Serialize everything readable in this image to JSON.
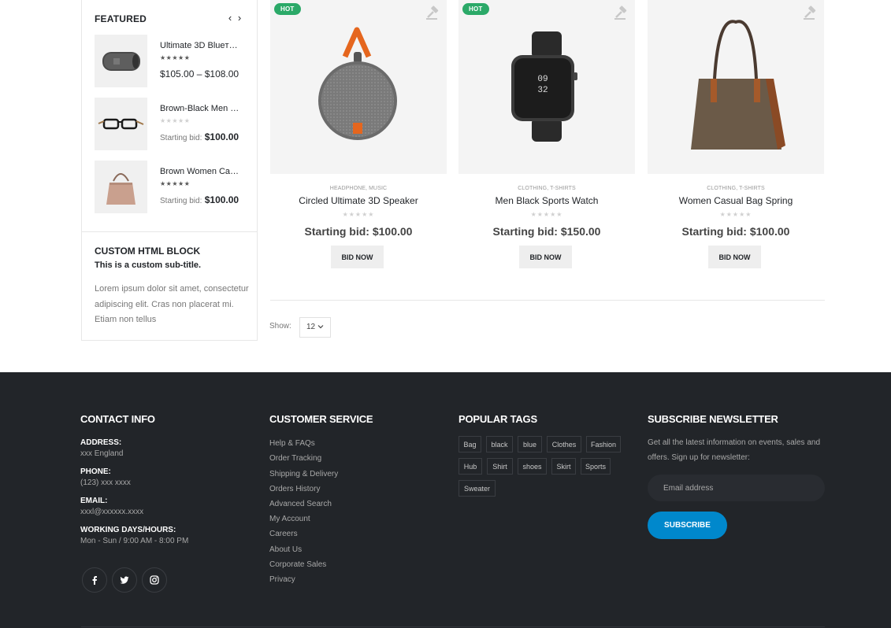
{
  "sidebar": {
    "featured_title": "FEATURED",
    "prev_label": "‹",
    "next_label": "›",
    "items": [
      {
        "name": "Ultimate 3D Blueт…",
        "stars": "★★★★★",
        "price": "$105.00 – $108.00",
        "price_label": ""
      },
      {
        "name": "Brown-Black Men …",
        "stars": "★★★★★",
        "price": "$100.00",
        "price_label": "Starting bid:"
      },
      {
        "name": "Brown Women Ca…",
        "stars": "★★★★★",
        "price": "$100.00",
        "price_label": "Starting bid:"
      }
    ],
    "custom_block": {
      "title": "CUSTOM HTML BLOCK",
      "subtitle": "This is a custom sub-title.",
      "text": "Lorem ipsum dolor sit amet, consectetur adipiscing elit. Cras non placerat mi. Etiam non tellus"
    }
  },
  "products": [
    {
      "badge": "HOT",
      "categories": "HEADPHONE, MUSIC",
      "name": "Circled Ultimate 3D Speaker",
      "stars": "★★★★★",
      "price": "Starting bid: $100.00",
      "button": "BID NOW",
      "icon": "speaker-image"
    },
    {
      "badge": "HOT",
      "categories": "CLOTHING, T-SHIRTS",
      "name": "Men Black Sports Watch",
      "stars": "★★★★★",
      "price": "Starting bid: $150.00",
      "button": "BID NOW",
      "icon": "watch-image"
    },
    {
      "badge": "",
      "categories": "CLOTHING, T-SHIRTS",
      "name": "Women Casual Bag Spring",
      "stars": "★★★★★",
      "price": "Starting bid: $100.00",
      "button": "BID NOW",
      "icon": "bag-image"
    }
  ],
  "toolbar": {
    "show_label": "Show:",
    "show_value": "12"
  },
  "footer": {
    "contact": {
      "title": "CONTACT INFO",
      "address_label": "ADDRESS:",
      "address": "xxx England",
      "phone_label": "PHONE:",
      "phone": "(123) xxx xxxx",
      "email_label": "EMAIL:",
      "email": "xxxl@xxxxxx.xxxx",
      "hours_label": "WORKING DAYS/HOURS:",
      "hours": "Mon - Sun / 9:00 AM - 8:00 PM"
    },
    "service": {
      "title": "CUSTOMER SERVICE",
      "links": [
        "Help & FAQs",
        "Order Tracking",
        "Shipping & Delivery",
        "Orders History",
        "Advanced Search",
        "My Account",
        "Careers",
        "About Us",
        "Corporate Sales",
        "Privacy"
      ]
    },
    "tags": {
      "title": "POPULAR TAGS",
      "items": [
        "Bag",
        "black",
        "blue",
        "Clothes",
        "Fashion",
        "Hub",
        "Shirt",
        "shoes",
        "Skirt",
        "Sports",
        "Sweater"
      ]
    },
    "newsletter": {
      "title": "SUBSCRIBE NEWSLETTER",
      "text": "Get all the latest information on events, sales and offers. Sign up for newsletter:",
      "placeholder": "Email address",
      "button": "SUBSCRIBE"
    }
  },
  "colors": {
    "hot_badge": "#2ba968",
    "footer_bg": "#222529",
    "subscribe_button": "#0088cc"
  }
}
